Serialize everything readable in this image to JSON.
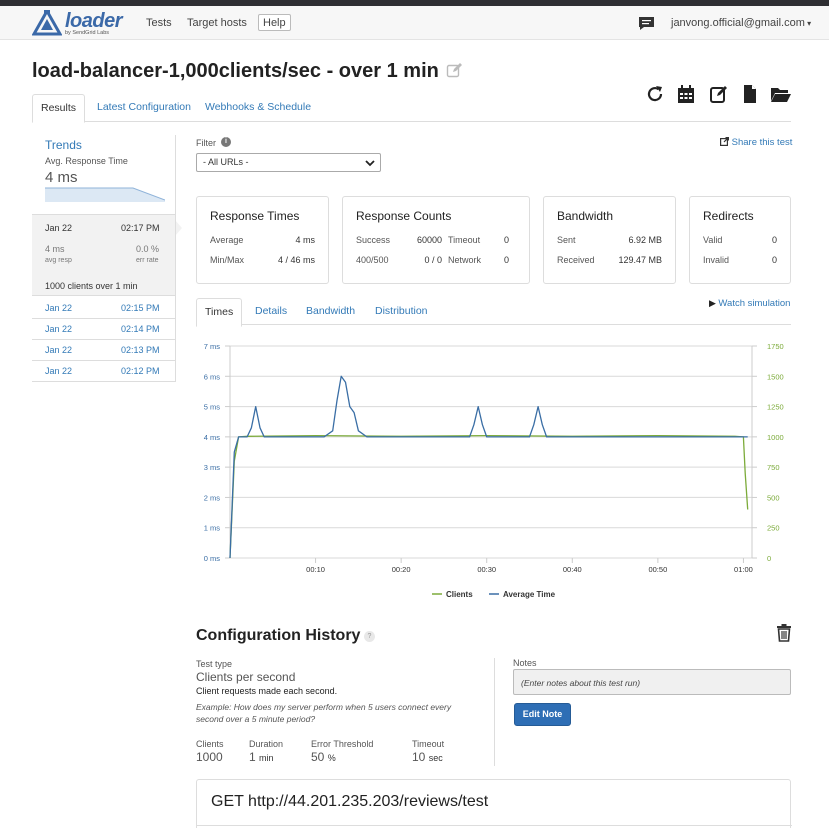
{
  "nav": {
    "logo_text": "loader",
    "logo_sub": "by SendGrid Labs",
    "links": [
      "Tests",
      "Target hosts"
    ],
    "help": "Help",
    "user_email": "janvong.official@gmail.com"
  },
  "page": {
    "title": "load-balancer-1,000clients/sec - over 1 min"
  },
  "tabs": [
    "Results",
    "Latest Configuration",
    "Webhooks & Schedule"
  ],
  "toolbar": {
    "icons": [
      "refresh-icon",
      "calendar-icon",
      "edit-icon",
      "file-icon",
      "folder-open-icon"
    ]
  },
  "sidebar": {
    "trends_title": "Trends",
    "trends_sub": "Avg. Response Time",
    "trends_value": "4 ms",
    "selected_run": {
      "date": "Jan 22",
      "time": "02:17 PM",
      "avg_resp": "4 ms",
      "avg_resp_label": "avg resp",
      "err_rate": "0.0 %",
      "err_rate_label": "err rate",
      "clients": "1000 clients over 1 min"
    },
    "runs": [
      {
        "date": "Jan 22",
        "time": "02:15 PM"
      },
      {
        "date": "Jan 22",
        "time": "02:14 PM"
      },
      {
        "date": "Jan 22",
        "time": "02:13 PM"
      },
      {
        "date": "Jan 22",
        "time": "02:12 PM"
      }
    ]
  },
  "filter": {
    "label": "Filter",
    "selected": "- All URLs -"
  },
  "share_label": "Share this test",
  "cards": {
    "response_times": {
      "title": "Response Times",
      "average_label": "Average",
      "average": "4 ms",
      "minmax_label": "Min/Max",
      "minmax": "4 / 46 ms"
    },
    "response_counts": {
      "title": "Response Counts",
      "success_label": "Success",
      "success": "60000",
      "timeout_label": "Timeout",
      "timeout": "0",
      "c400_label": "400/500",
      "c400": "0 / 0",
      "network_label": "Network",
      "network": "0"
    },
    "bandwidth": {
      "title": "Bandwidth",
      "sent_label": "Sent",
      "sent": "6.92 MB",
      "received_label": "Received",
      "received": "129.47 MB"
    },
    "redirects": {
      "title": "Redirects",
      "valid_label": "Valid",
      "valid": "0",
      "invalid_label": "Invalid",
      "invalid": "0"
    }
  },
  "chart_tabs": [
    "Times",
    "Details",
    "Bandwidth",
    "Distribution"
  ],
  "watch_label": "Watch simulation",
  "chart_data": {
    "type": "line",
    "y_left_ticks": [
      "0 ms",
      "1 ms",
      "2 ms",
      "3 ms",
      "4 ms",
      "5 ms",
      "6 ms",
      "7 ms"
    ],
    "y_right_ticks": [
      "0",
      "250",
      "500",
      "750",
      "1000",
      "1250",
      "1500",
      "1750"
    ],
    "x_ticks": [
      "00:10",
      "00:20",
      "00:30",
      "00:40",
      "00:50",
      "01:00"
    ],
    "ylim_left": [
      0,
      7
    ],
    "ylim_right": [
      0,
      1750
    ],
    "xlim": [
      0,
      61
    ],
    "series": [
      {
        "name": "Clients",
        "axis": "right",
        "color": "#7cab3a",
        "x": [
          0,
          0.5,
          1,
          2,
          10,
          20,
          30,
          40,
          50,
          59,
          60,
          60.2,
          60.5
        ],
        "y": [
          0,
          800,
          1000,
          1005,
          1010,
          1005,
          1010,
          1005,
          1010,
          1005,
          1000,
          700,
          400
        ]
      },
      {
        "name": "Average Time",
        "axis": "left",
        "color": "#3a6ea5",
        "x": [
          0,
          0.5,
          1,
          2,
          2.5,
          3,
          3.5,
          4,
          4.5,
          10,
          11,
          12,
          12.5,
          13,
          13.5,
          14,
          14.5,
          15,
          16,
          28,
          28.5,
          29,
          29.5,
          30,
          35,
          35.5,
          36,
          36.5,
          37,
          60,
          60.5
        ],
        "y": [
          0,
          3.5,
          4,
          4,
          4.3,
          5,
          4.3,
          4,
          4,
          4,
          4,
          4.2,
          5.2,
          6,
          5.8,
          5,
          4.8,
          4.2,
          4,
          4,
          4.4,
          5,
          4.4,
          4,
          4,
          4.4,
          5,
          4.4,
          4,
          4,
          4
        ]
      }
    ],
    "legend": [
      "Clients",
      "Average Time"
    ],
    "legend_position": "bottom"
  },
  "config": {
    "title": "Configuration History",
    "help": "?",
    "test_type_label": "Test type",
    "test_type": "Clients per second",
    "test_desc": "Client requests made each second.",
    "example": "Example: How does my server perform when 5 users connect every second over a 5 minute period?",
    "clients_label": "Clients",
    "clients": "1000",
    "duration_label": "Duration",
    "duration": "1",
    "duration_unit": "min",
    "error_label": "Error Threshold",
    "error": "50",
    "error_unit": "%",
    "timeout_label": "Timeout",
    "timeout": "10",
    "timeout_unit": "sec",
    "notes_label": "Notes",
    "notes_placeholder": "(Enter notes about this test run)",
    "edit_note": "Edit Note",
    "request": "GET http://44.201.235.203/reviews/test"
  }
}
